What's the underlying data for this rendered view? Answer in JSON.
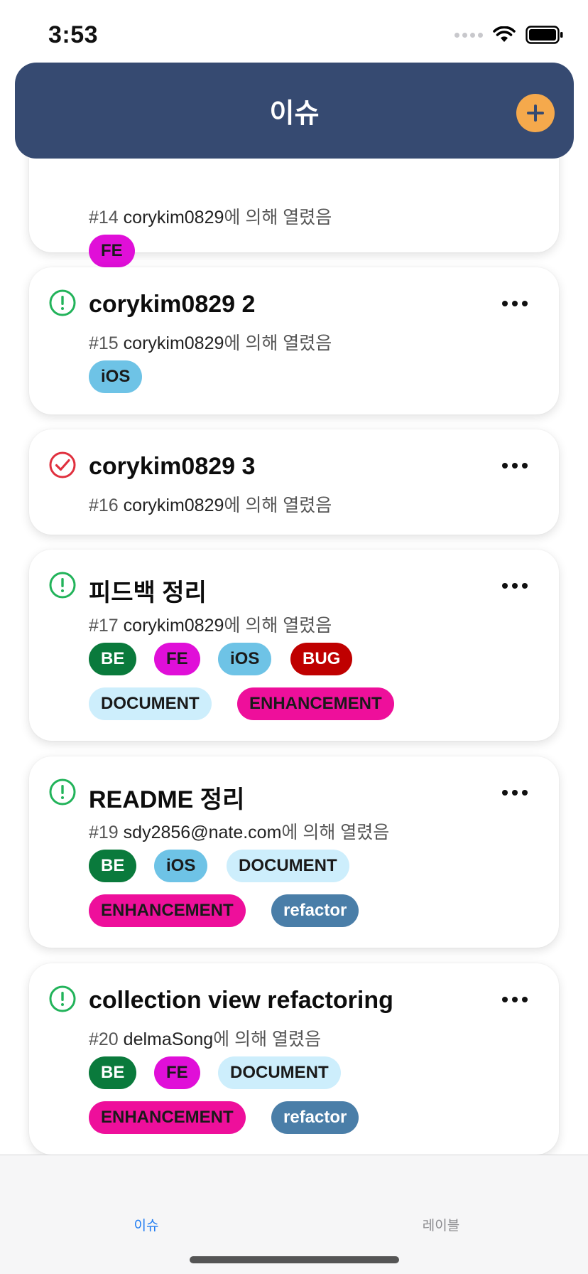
{
  "status_bar": {
    "time": "3:53"
  },
  "header": {
    "title": "이슈",
    "add_icon": "plus-icon"
  },
  "issues": [
    {
      "title": "",
      "number": "#14",
      "author": "corykim0829",
      "suffix": "에 의해 열렸음",
      "state": "open",
      "labels": [
        {
          "text": "FE",
          "bg": "#e00fd8",
          "fg": "#1a1a1a"
        }
      ]
    },
    {
      "title": "corykim0829 2",
      "number": "#15",
      "author": "corykim0829",
      "suffix": "에 의해 열렸음",
      "state": "open",
      "labels": [
        {
          "text": "iOS",
          "bg": "#6ec3e6",
          "fg": "#1a1a1a"
        }
      ]
    },
    {
      "title": "corykim0829 3",
      "number": "#16",
      "author": "corykim0829",
      "suffix": "에 의해 열렸음",
      "state": "closed",
      "labels": []
    },
    {
      "title": "피드백 정리",
      "number": "#17",
      "author": "corykim0829",
      "suffix": "에 의해 열렸음",
      "state": "open",
      "labels": [
        {
          "text": "BE",
          "bg": "#0a7a3c",
          "fg": "#ffffff"
        },
        {
          "text": "FE",
          "bg": "#e00fd8",
          "fg": "#1a1a1a"
        },
        {
          "text": "iOS",
          "bg": "#6ec3e6",
          "fg": "#1a1a1a"
        },
        {
          "text": "BUG",
          "bg": "#bf0000",
          "fg": "#ffffff"
        },
        {
          "text": "DOCUMENT",
          "bg": "#cdeefc",
          "fg": "#1a1a1a"
        },
        {
          "text": "ENHANCEMENT",
          "bg": "#ee0f9b",
          "fg": "#1a1a1a"
        }
      ]
    },
    {
      "title": "README 정리",
      "number": "#19",
      "author": "sdy2856@nate.com",
      "suffix": "에 의해 열렸음",
      "state": "open",
      "labels": [
        {
          "text": "BE",
          "bg": "#0a7a3c",
          "fg": "#ffffff"
        },
        {
          "text": "iOS",
          "bg": "#6ec3e6",
          "fg": "#1a1a1a"
        },
        {
          "text": "DOCUMENT",
          "bg": "#cdeefc",
          "fg": "#1a1a1a"
        },
        {
          "text": "ENHANCEMENT",
          "bg": "#ee0f9b",
          "fg": "#1a1a1a"
        },
        {
          "text": "refactor",
          "bg": "#4a7ea8",
          "fg": "#ffffff"
        }
      ]
    },
    {
      "title": "collection view refactoring",
      "number": "#20",
      "author": "delmaSong",
      "suffix": "에 의해 열렸음",
      "state": "open",
      "labels": [
        {
          "text": "BE",
          "bg": "#0a7a3c",
          "fg": "#ffffff"
        },
        {
          "text": "FE",
          "bg": "#e00fd8",
          "fg": "#1a1a1a"
        },
        {
          "text": "DOCUMENT",
          "bg": "#cdeefc",
          "fg": "#1a1a1a"
        },
        {
          "text": "ENHANCEMENT",
          "bg": "#ee0f9b",
          "fg": "#1a1a1a"
        },
        {
          "text": "refactor",
          "bg": "#4a7ea8",
          "fg": "#ffffff"
        }
      ]
    }
  ],
  "tab_bar": {
    "issues_label": "이슈",
    "labels_label": "레이블"
  },
  "colors": {
    "header": "#364a71",
    "accent": "#f5a94c",
    "open": "#22b35a",
    "closed": "#e0303e",
    "tab_active": "#1e7bf2"
  }
}
